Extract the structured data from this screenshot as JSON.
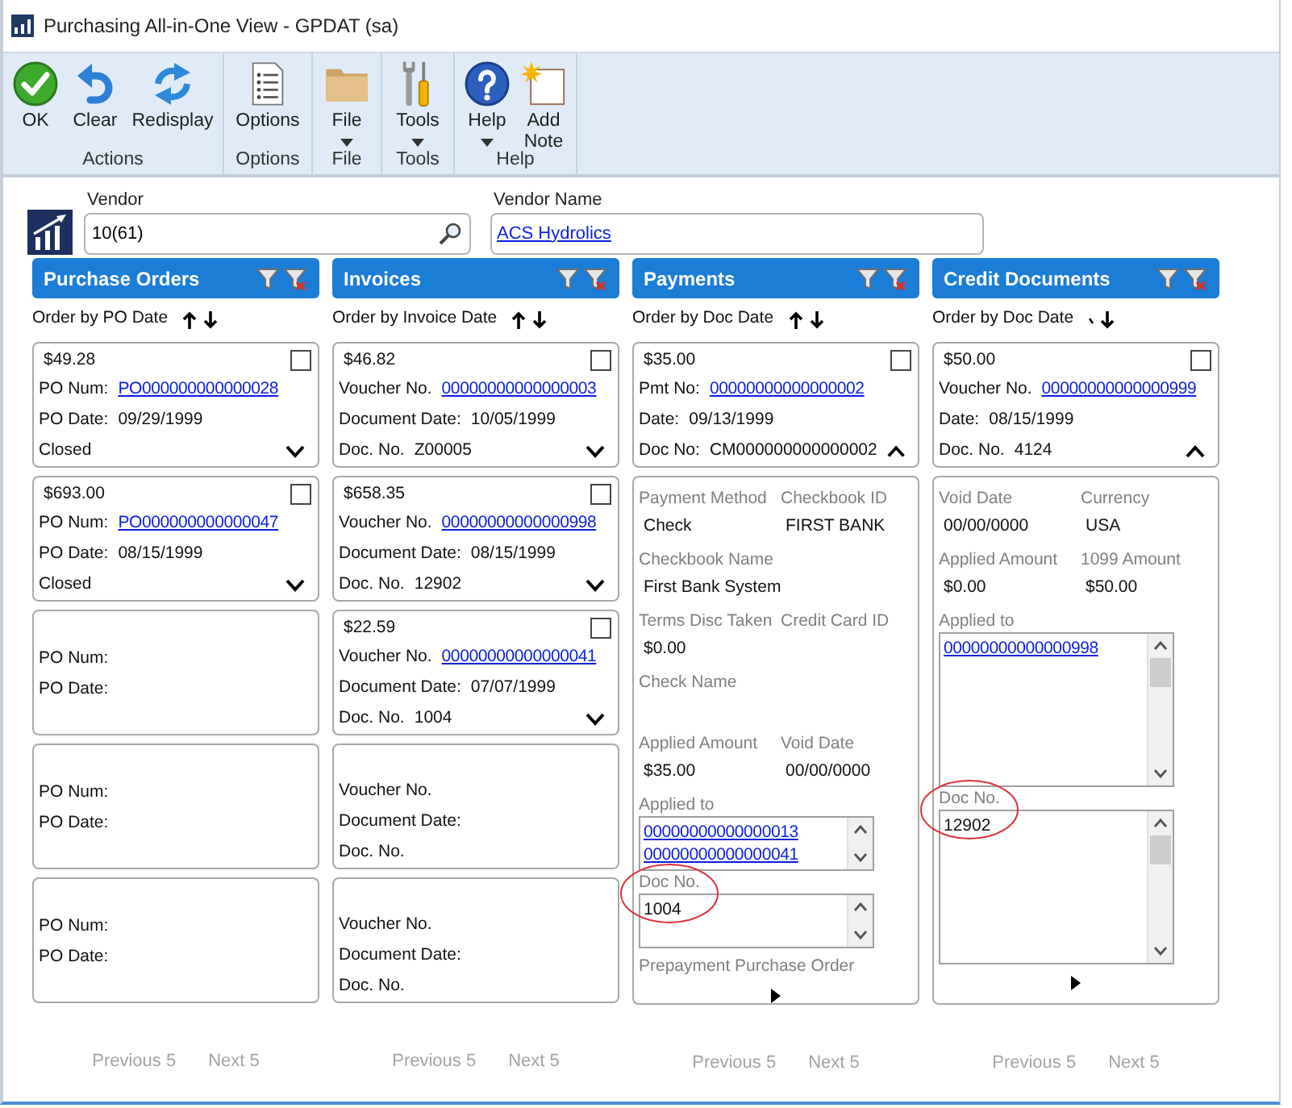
{
  "window": {
    "title": "Purchasing All-in-One View - GPDAT (sa)"
  },
  "ribbon": {
    "groups": [
      {
        "label": "Actions",
        "buttons": [
          {
            "label": "OK",
            "kind": "ok",
            "dropdown": false
          },
          {
            "label": "Clear",
            "kind": "clear",
            "dropdown": false
          },
          {
            "label": "Redisplay",
            "kind": "redisplay",
            "dropdown": false
          }
        ]
      },
      {
        "label": "Options",
        "buttons": [
          {
            "label": "Options",
            "kind": "options",
            "dropdown": false
          }
        ]
      },
      {
        "label": "File",
        "buttons": [
          {
            "label": "File",
            "kind": "file",
            "dropdown": true
          }
        ]
      },
      {
        "label": "Tools",
        "buttons": [
          {
            "label": "Tools",
            "kind": "tools",
            "dropdown": true
          }
        ]
      },
      {
        "label": "Help",
        "buttons": [
          {
            "label": "Help",
            "kind": "help",
            "dropdown": true
          },
          {
            "label": "Add Note",
            "kind": "note",
            "dropdown": false
          }
        ]
      }
    ]
  },
  "vendor": {
    "label": "Vendor",
    "value": "10(61)"
  },
  "vendor_name": {
    "label": "Vendor Name",
    "value": "ACS Hydrolics"
  },
  "columns": [
    {
      "title": "Purchase Orders",
      "order_by": "Order by PO Date",
      "sort_up_partial": false,
      "cards": [
        {
          "kind": "record",
          "amount": "$49.28",
          "checked": false,
          "expanded": false,
          "rows": [
            {
              "label": "PO Num:",
              "value": "PO000000000000028",
              "link": true
            },
            {
              "label": "PO Date:",
              "value": "09/29/1999",
              "link": false
            },
            {
              "value": "Closed",
              "link": false
            }
          ]
        },
        {
          "kind": "record",
          "amount": "$693.00",
          "checked": false,
          "expanded": false,
          "rows": [
            {
              "label": "PO Num:",
              "value": "PO000000000000047",
              "link": true
            },
            {
              "label": "PO Date:",
              "value": "08/15/1999",
              "link": false
            },
            {
              "value": "Closed",
              "link": false
            }
          ]
        },
        {
          "kind": "blank",
          "rows": [
            {
              "label": "PO Num:"
            },
            {
              "label": "PO Date:"
            }
          ]
        },
        {
          "kind": "blank",
          "rows": [
            {
              "label": "PO Num:"
            },
            {
              "label": "PO Date:"
            }
          ]
        },
        {
          "kind": "blank",
          "rows": [
            {
              "label": "PO Num:"
            },
            {
              "label": "PO Date:"
            }
          ]
        }
      ],
      "pager": {
        "previous": {
          "label": "Previous 5",
          "disabled": true
        },
        "next": {
          "label": "Next 5",
          "disabled": true
        }
      }
    },
    {
      "title": "Invoices",
      "order_by": "Order by Invoice Date",
      "sort_up_partial": false,
      "cards": [
        {
          "kind": "record",
          "amount": "$46.82",
          "checked": false,
          "expanded": false,
          "rows": [
            {
              "label": "Voucher No.",
              "value": "00000000000000003",
              "link": true
            },
            {
              "label": "Document Date:",
              "value": "10/05/1999",
              "link": false
            },
            {
              "label": "Doc. No.",
              "value": "Z00005",
              "link": false
            }
          ]
        },
        {
          "kind": "record",
          "amount": "$658.35",
          "checked": false,
          "expanded": false,
          "rows": [
            {
              "label": "Voucher No.",
              "value": "00000000000000998",
              "link": true
            },
            {
              "label": "Document Date:",
              "value": "08/15/1999",
              "link": false
            },
            {
              "label": "Doc. No.",
              "value": "12902",
              "link": false
            }
          ]
        },
        {
          "kind": "record",
          "amount": "$22.59",
          "checked": false,
          "expanded": false,
          "rows": [
            {
              "label": "Voucher No.",
              "value": "00000000000000041",
              "link": true
            },
            {
              "label": "Document Date:",
              "value": "07/07/1999",
              "link": false
            },
            {
              "label": "Doc. No.",
              "value": "1004",
              "link": false
            }
          ]
        },
        {
          "kind": "blank",
          "rows": [
            {
              "label": "Voucher No."
            },
            {
              "label": "Document Date:"
            },
            {
              "label": "Doc. No."
            }
          ]
        },
        {
          "kind": "blank",
          "rows": [
            {
              "label": "Voucher No."
            },
            {
              "label": "Document Date:"
            },
            {
              "label": "Doc. No."
            }
          ]
        }
      ],
      "pager": {
        "previous": {
          "label": "Previous 5",
          "disabled": true
        },
        "next": {
          "label": "Next 5",
          "disabled": true
        }
      }
    },
    {
      "title": "Payments",
      "order_by": "Order by Doc Date",
      "sort_up_partial": false,
      "cards": [
        {
          "kind": "record",
          "amount": "$35.00",
          "checked": false,
          "expanded": true,
          "rows": [
            {
              "label": "Pmt No:",
              "value": "00000000000000002",
              "link": true
            },
            {
              "label": "Date:",
              "value": "09/13/1999",
              "link": false
            },
            {
              "label": "Doc No:",
              "value": "CM000000000000002",
              "link": false
            }
          ]
        },
        {
          "kind": "detail",
          "sections": [
            {
              "kind": "fields",
              "fields": [
                {
                  "label": "Payment Method",
                  "value": "Check"
                },
                {
                  "label": "Checkbook ID",
                  "value": "FIRST BANK"
                }
              ]
            },
            {
              "kind": "fields",
              "fields": [
                {
                  "label": "Checkbook Name",
                  "value": "First Bank System"
                }
              ]
            },
            {
              "kind": "fields",
              "fields": [
                {
                  "label": "Terms Disc Taken",
                  "value": "$0.00"
                },
                {
                  "label": "Credit Card ID"
                }
              ]
            },
            {
              "kind": "fields",
              "fields": [
                {
                  "label": "Check Name"
                }
              ]
            },
            {
              "kind": "fields",
              "fields": [
                {
                  "label": "Applied Amount",
                  "value": "$35.00"
                },
                {
                  "label": "Void Date",
                  "value": "00/00/0000"
                }
              ]
            },
            {
              "kind": "listbox",
              "label": "Applied to",
              "items": [
                {
                  "text": "00000000000000013",
                  "link": true
                },
                {
                  "text": "00000000000000041",
                  "link": true
                }
              ],
              "scroll_thumb": false,
              "circled": false
            },
            {
              "kind": "listbox",
              "label": "Doc No.",
              "items": [
                {
                  "text": "1004",
                  "link": false
                }
              ],
              "scroll_thumb": false,
              "circled": true
            },
            {
              "kind": "caption",
              "label": "Prepayment Purchase Order"
            }
          ]
        }
      ],
      "pager": {
        "previous": {
          "label": "Previous 5",
          "disabled": true
        },
        "next": {
          "label": "Next 5",
          "disabled": true
        }
      }
    },
    {
      "title": "Credit Documents",
      "order_by": "Order by Doc Date",
      "sort_up_partial": true,
      "cards": [
        {
          "kind": "record",
          "amount": "$50.00",
          "checked": false,
          "expanded": true,
          "rows": [
            {
              "label": "Voucher No.",
              "value": "00000000000000999",
              "link": true
            },
            {
              "label": "Date:",
              "value": "08/15/1999",
              "link": false
            },
            {
              "label": "Doc. No.",
              "value": "4124",
              "link": false
            }
          ]
        },
        {
          "kind": "detail",
          "sections": [
            {
              "kind": "fields",
              "fields": [
                {
                  "label": "Void Date",
                  "value": "00/00/0000"
                },
                {
                  "label": "Currency",
                  "value": "USA"
                }
              ]
            },
            {
              "kind": "fields",
              "fields": [
                {
                  "label": "Applied Amount",
                  "value": "$0.00"
                },
                {
                  "label": "1099 Amount",
                  "value": "$50.00"
                }
              ]
            },
            {
              "kind": "listbox",
              "label": "Applied to",
              "items": [
                {
                  "text": "00000000000000998",
                  "link": true
                }
              ],
              "scroll_thumb": true,
              "circled": false
            },
            {
              "kind": "listbox",
              "label": "Doc No.",
              "items": [
                {
                  "text": "12902",
                  "link": false
                }
              ],
              "scroll_thumb": true,
              "circled": true
            }
          ]
        }
      ],
      "pager": {
        "previous": {
          "label": "Previous 5",
          "disabled": true
        },
        "next": {
          "label": "Next 5",
          "disabled": true
        }
      }
    }
  ]
}
